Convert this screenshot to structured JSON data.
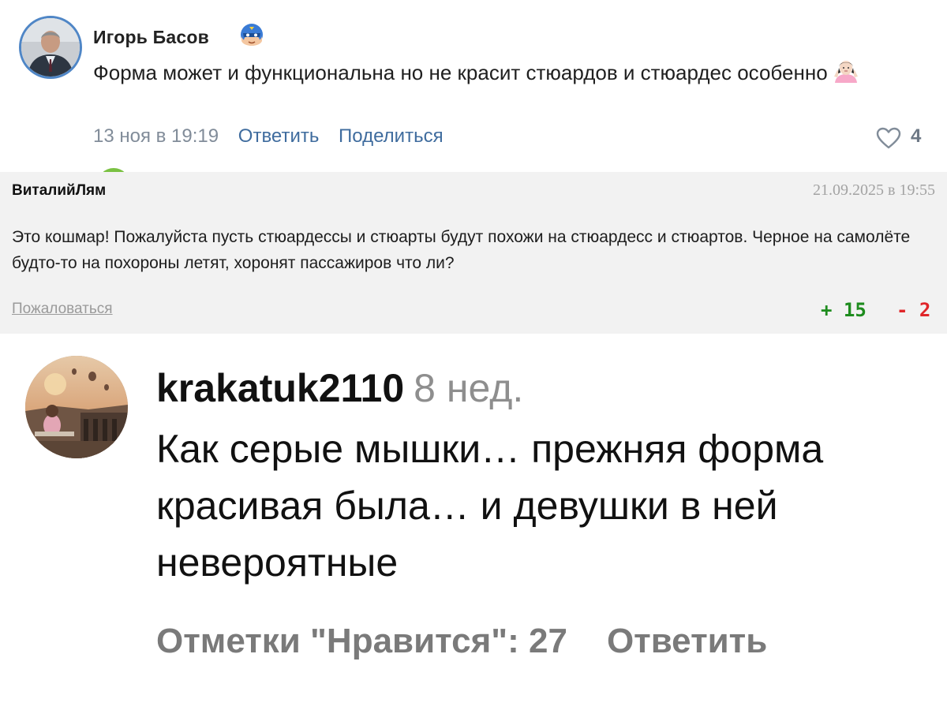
{
  "vk_comment": {
    "author": "Игорь Басов",
    "author_badge_icon": "superhero-emoji-icon",
    "text": "Форма может и функциональна но не красит стюардов и стюардес особенно",
    "text_emoji_icon": "woman-shrugging-emoji-icon",
    "date": "13 ноя в 19:19",
    "reply_label": "Ответить",
    "share_label": "Поделиться",
    "like_icon": "heart-icon",
    "like_count": "4",
    "accent_color": "#3f6c9e"
  },
  "forum_comment": {
    "author": "ВиталийЛям",
    "date": "21.09.2025 в 19:55",
    "text": "Это кошмар! Пожалуйста пусть стюардессы и стюарты будут похожи на стюардесс и стюартов. Черное на самолёте будто-то на похороны летят, хоронят пассажиров что ли?",
    "report_label": "Пожаловаться",
    "plus_label": "+ 15",
    "minus_label": "- 2",
    "plus_color": "#1e8c1e",
    "minus_color": "#e0262a",
    "background": "#f2f2f2"
  },
  "ig_comment": {
    "username": "krakatuk2110",
    "time": "8 нед.",
    "text": "Как серые мышки… прежняя форма красивая была… и девушки в ней невероятные",
    "likes_label": "Отметки \"Нравится\": 27",
    "reply_label": "Ответить"
  }
}
